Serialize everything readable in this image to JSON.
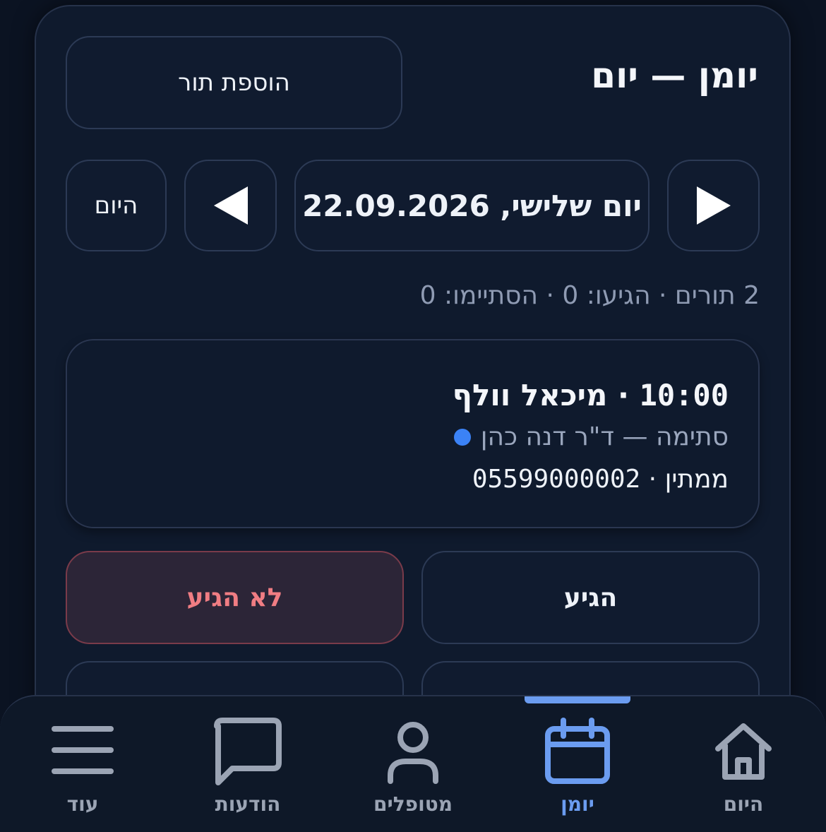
{
  "header": {
    "title": "יומן — יום",
    "add_button": "הוספת תור"
  },
  "date_nav": {
    "today_button": "היום",
    "prev_icon": "triangle-left-icon",
    "next_icon": "triangle-right-icon",
    "date_label": "יום שלישי, 22.09.2026"
  },
  "summary": "2 תורים · הגיעו: 0 · הסתיימו: 0",
  "appointment": {
    "time": "10:00",
    "separator": " · ",
    "patient": "מיכאל וולף",
    "service_doctor": "סתימה — ד\"ר דנה כהן",
    "status": "ממתין",
    "phone": "05599000002",
    "status_dot_color": "#3b82f6"
  },
  "actions": {
    "arrived": "הגיע",
    "no_show": "לא הגיע"
  },
  "tabs": [
    {
      "label": "היום",
      "icon": "home-icon"
    },
    {
      "label": "יומן",
      "icon": "calendar-icon",
      "active": true
    },
    {
      "label": "מטופלים",
      "icon": "user-icon"
    },
    {
      "label": "הודעות",
      "icon": "chat-icon"
    },
    {
      "label": "עוד",
      "icon": "menu-icon"
    }
  ],
  "colors": {
    "accent": "#6b9cf0",
    "danger_text": "#f07d83",
    "background": "#0b1322",
    "card": "#0f1a2d"
  }
}
